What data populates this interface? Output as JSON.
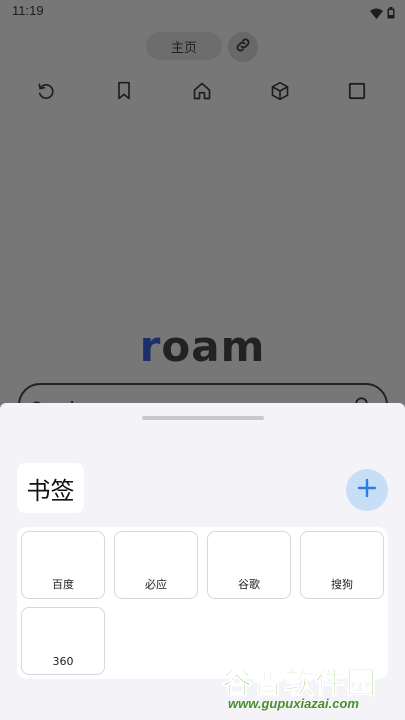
{
  "status_bar": {
    "time": "11:19",
    "icons": [
      "wifi-icon",
      "battery-icon"
    ]
  },
  "browser": {
    "address": "主页",
    "link_icon": "link-icon",
    "toolbar": [
      "refresh-icon",
      "bookmark-icon",
      "home-icon",
      "cube-icon",
      "tabs-icon"
    ],
    "logo": {
      "accent": "r",
      "rest": "oam",
      "accent_color": "#1a2f6b"
    },
    "search": {
      "placeholder": "Search"
    }
  },
  "sheet": {
    "title": "书签",
    "add_icon": "plus-icon",
    "bookmarks": [
      "百度",
      "必应",
      "谷歌",
      "搜狗",
      "360"
    ]
  },
  "watermark": {
    "name": "谷普软件园",
    "url": "www.gupuxiazai.com"
  },
  "colors": {
    "accent_blue": "#2a7de1",
    "add_button_bg": "#c8ddf6",
    "backdrop": "#777777",
    "watermark_green": "#5fb43a"
  }
}
